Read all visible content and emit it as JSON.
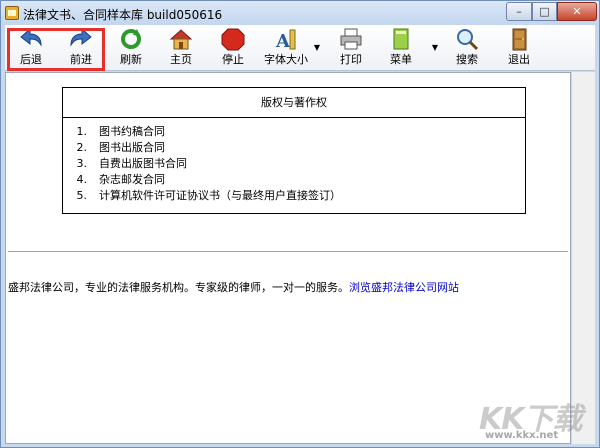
{
  "window": {
    "title": "法律文书、合同样本库 build050616"
  },
  "toolbar": {
    "items": [
      {
        "label": "后退",
        "icon": "back-arrow-icon"
      },
      {
        "label": "前进",
        "icon": "forward-arrow-icon"
      },
      {
        "label": "刷新",
        "icon": "refresh-icon"
      },
      {
        "label": "主页",
        "icon": "home-icon"
      },
      {
        "label": "停止",
        "icon": "stop-icon"
      },
      {
        "label": "字体大小",
        "icon": "font-size-icon"
      },
      {
        "label": "打印",
        "icon": "printer-icon"
      },
      {
        "label": "菜单",
        "icon": "menu-book-icon"
      },
      {
        "label": "搜索",
        "icon": "search-icon"
      },
      {
        "label": "退出",
        "icon": "exit-door-icon"
      }
    ]
  },
  "toc": {
    "heading": "版权与著作权",
    "items": [
      {
        "num": "1.",
        "text": "图书约稿合同"
      },
      {
        "num": "2.",
        "text": "图书出版合同"
      },
      {
        "num": "3.",
        "text": "自费出版图书合同"
      },
      {
        "num": "4.",
        "text": "杂志邮发合同"
      },
      {
        "num": "5.",
        "text": "计算机软件许可证协议书（与最终用户直接签订）"
      }
    ]
  },
  "footer": {
    "text": "盛邦法律公司，专业的法律服务机构。专家级的律师，一对一的服务。",
    "link": "浏览盛邦法律公司网站"
  },
  "watermark": {
    "brand": "KK下载",
    "url": "www.kkx.net"
  }
}
